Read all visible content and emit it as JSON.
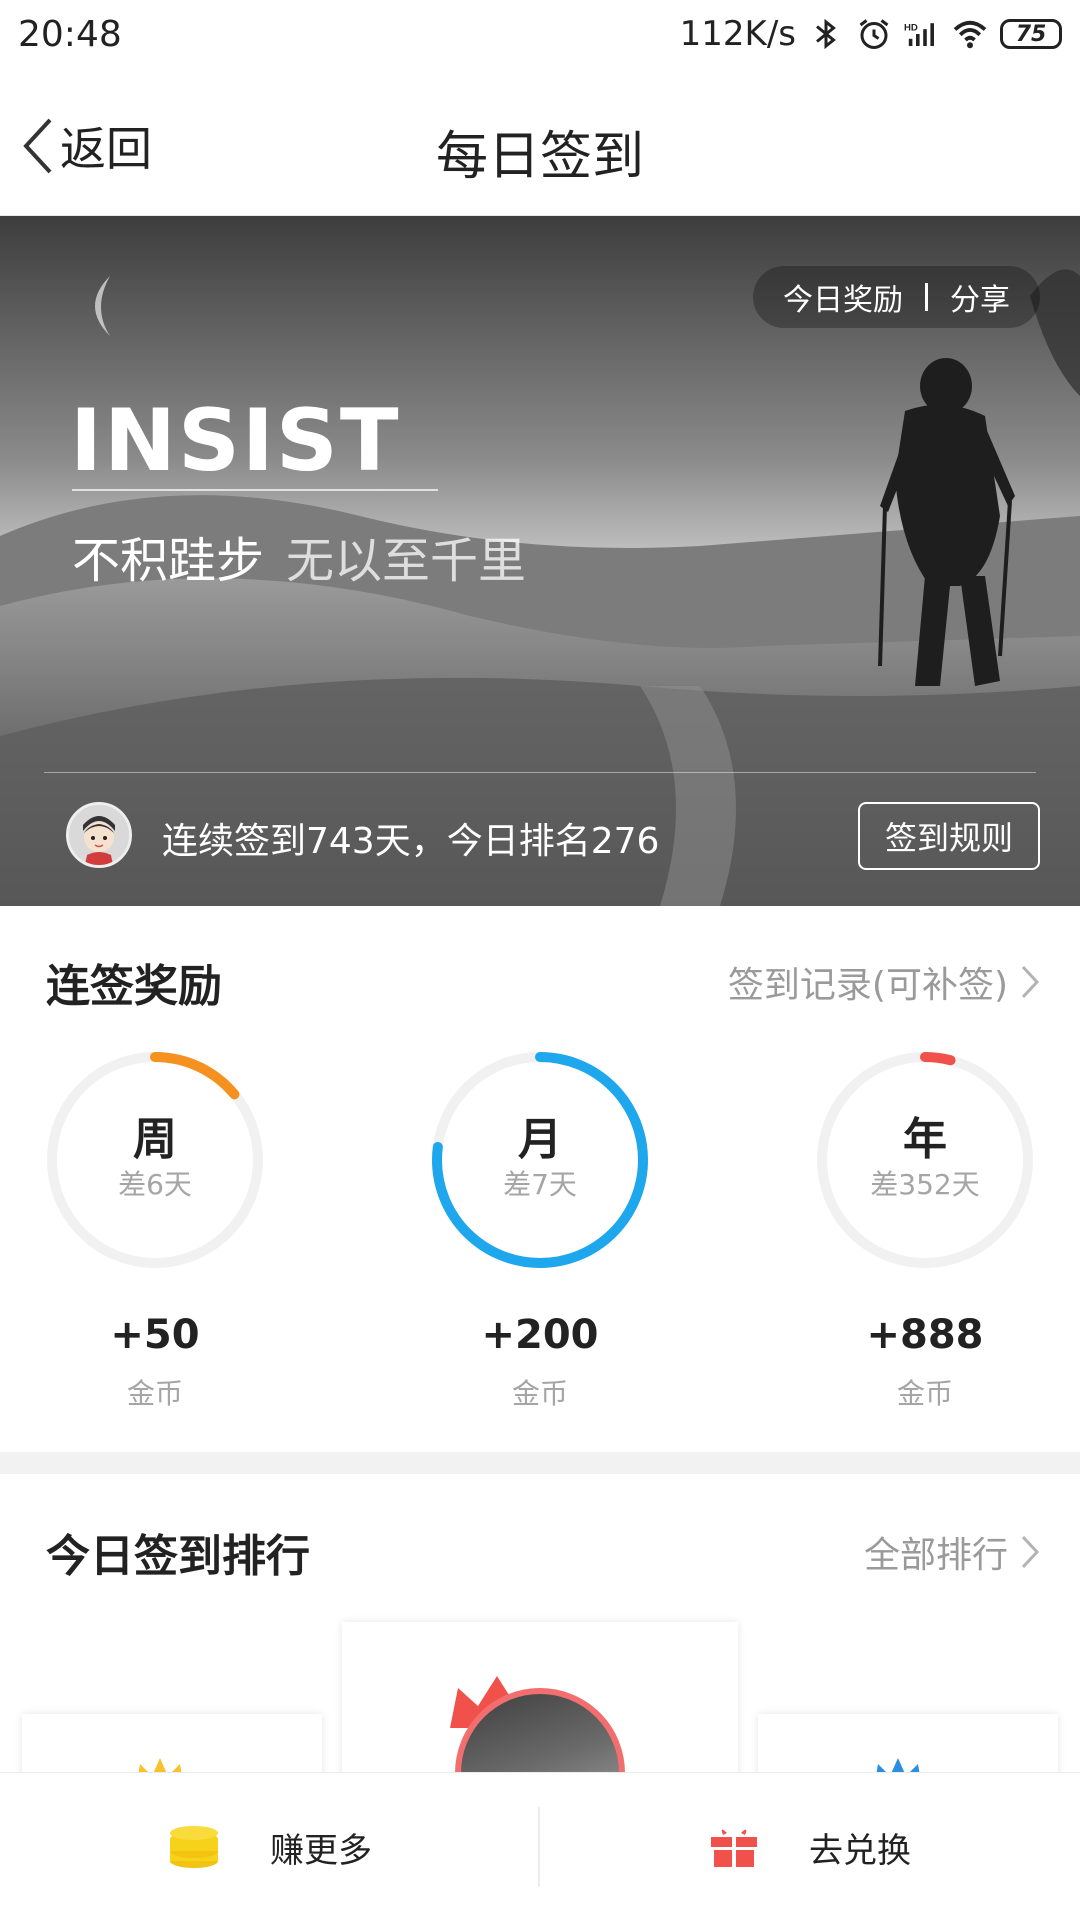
{
  "status_bar": {
    "time": "20:48",
    "net_speed": "112K/s",
    "battery": "75",
    "icons": [
      "bluetooth-icon",
      "alarm-icon",
      "hd-signal-icon",
      "wifi-icon",
      "battery-icon"
    ]
  },
  "nav": {
    "back_label": "返回",
    "title": "每日签到"
  },
  "banner": {
    "today_reward": "今日奖励",
    "share": "分享",
    "headline": "INSIST",
    "motto_main": "不积跬步",
    "motto_rest": "无以至千里",
    "streak_text": "连续签到743天，今日排名276",
    "rules_button": "签到规则"
  },
  "streak_rewards": {
    "title": "连签奖励",
    "link": "签到记录(可补签)",
    "items": [
      {
        "period": "周",
        "remaining": "差6天",
        "reward": "+50",
        "unit": "金币",
        "progress": 0.14,
        "color": "#f5911e"
      },
      {
        "period": "月",
        "remaining": "差7天",
        "reward": "+200",
        "unit": "金币",
        "progress": 0.77,
        "color": "#1ea7ec"
      },
      {
        "period": "年",
        "remaining": "差352天",
        "reward": "+888",
        "unit": "金币",
        "progress": 0.04,
        "color": "#f0524b"
      }
    ]
  },
  "ranking": {
    "title": "今日签到排行",
    "link": "全部排行"
  },
  "bottom_bar": {
    "earn_more": "赚更多",
    "redeem": "去兑换"
  },
  "colors": {
    "coin": "#f7d21a",
    "gift": "#f0524b",
    "crown": "#f0524b"
  }
}
